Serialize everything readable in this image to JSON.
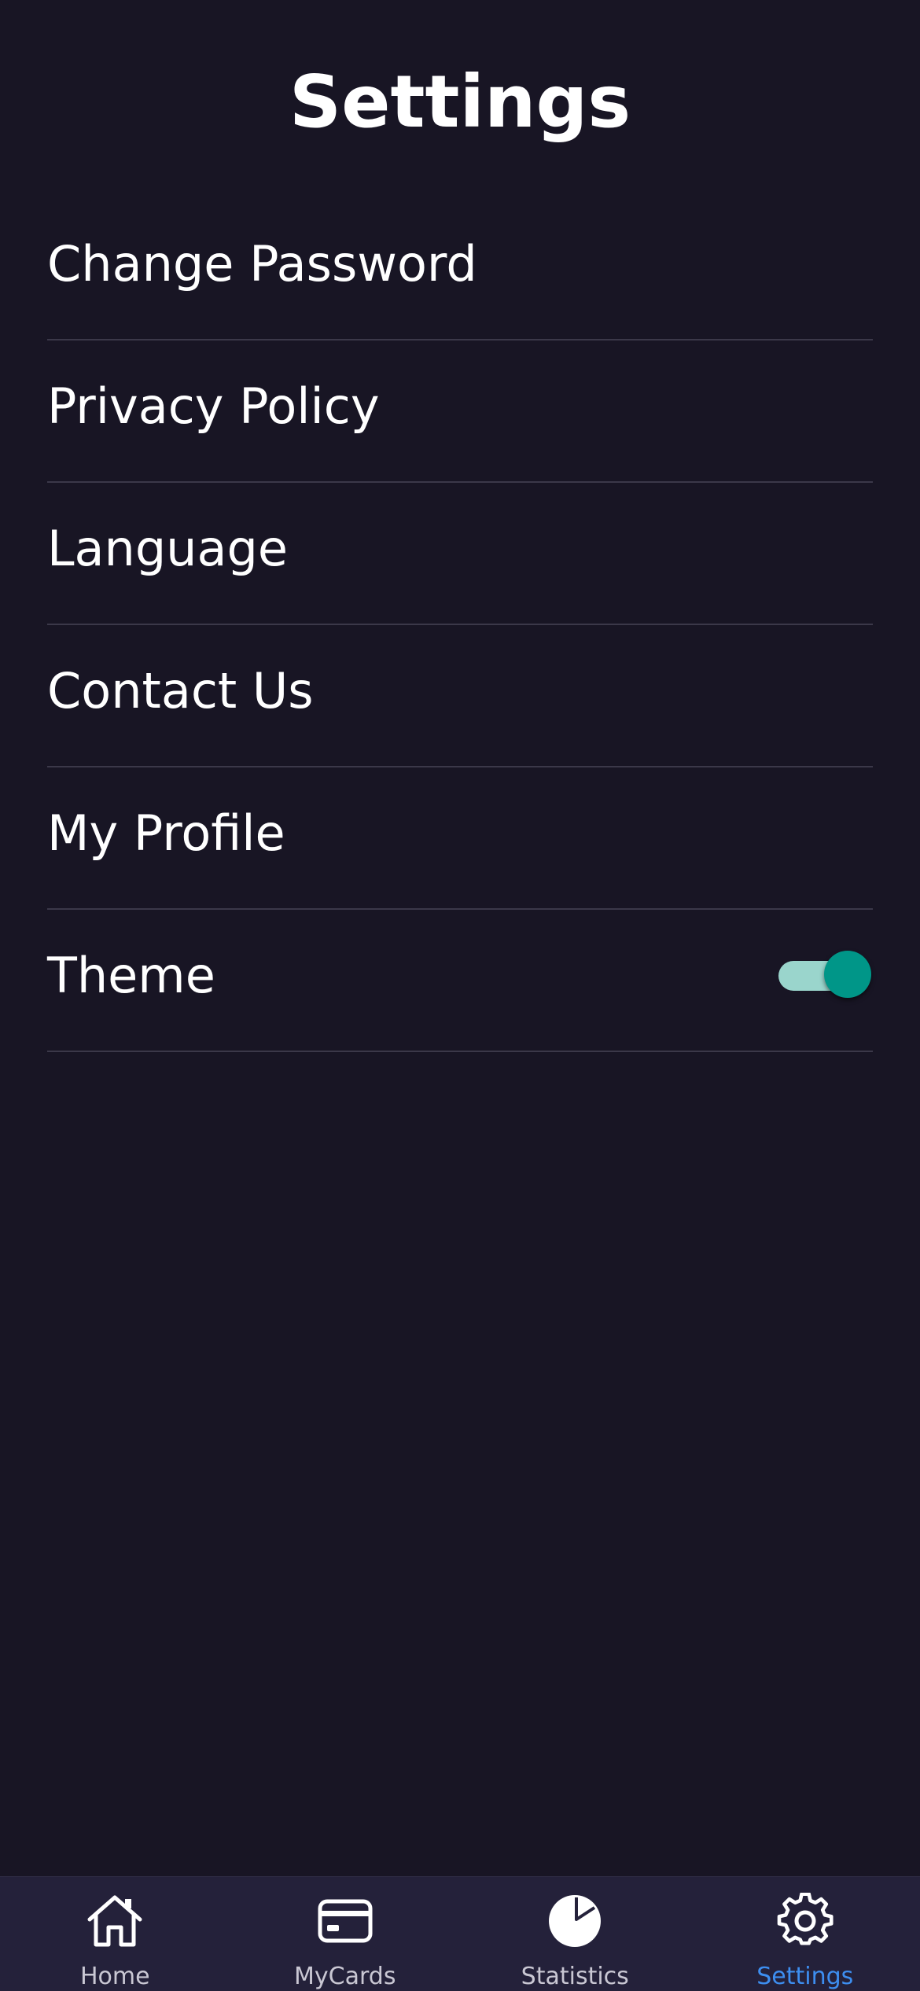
{
  "header": {
    "title": "Settings"
  },
  "settings": {
    "items": [
      {
        "label": "Change Password"
      },
      {
        "label": "Privacy Policy"
      },
      {
        "label": "Language"
      },
      {
        "label": "Contact Us"
      },
      {
        "label": "My Profile"
      },
      {
        "label": "Theme",
        "toggle_on": true
      }
    ]
  },
  "bottom_nav": {
    "items": [
      {
        "label": "Home",
        "icon": "home-icon",
        "active": false
      },
      {
        "label": "MyCards",
        "icon": "card-icon",
        "active": false
      },
      {
        "label": "Statistics",
        "icon": "pie-chart-icon",
        "active": false
      },
      {
        "label": "Settings",
        "icon": "gear-icon",
        "active": true
      }
    ]
  },
  "colors": {
    "background": "#181524",
    "nav_background": "#24213a",
    "divider": "#3b3849",
    "accent_active": "#3d8ef0",
    "toggle_thumb": "#009688",
    "toggle_track": "#9ad5cc"
  }
}
